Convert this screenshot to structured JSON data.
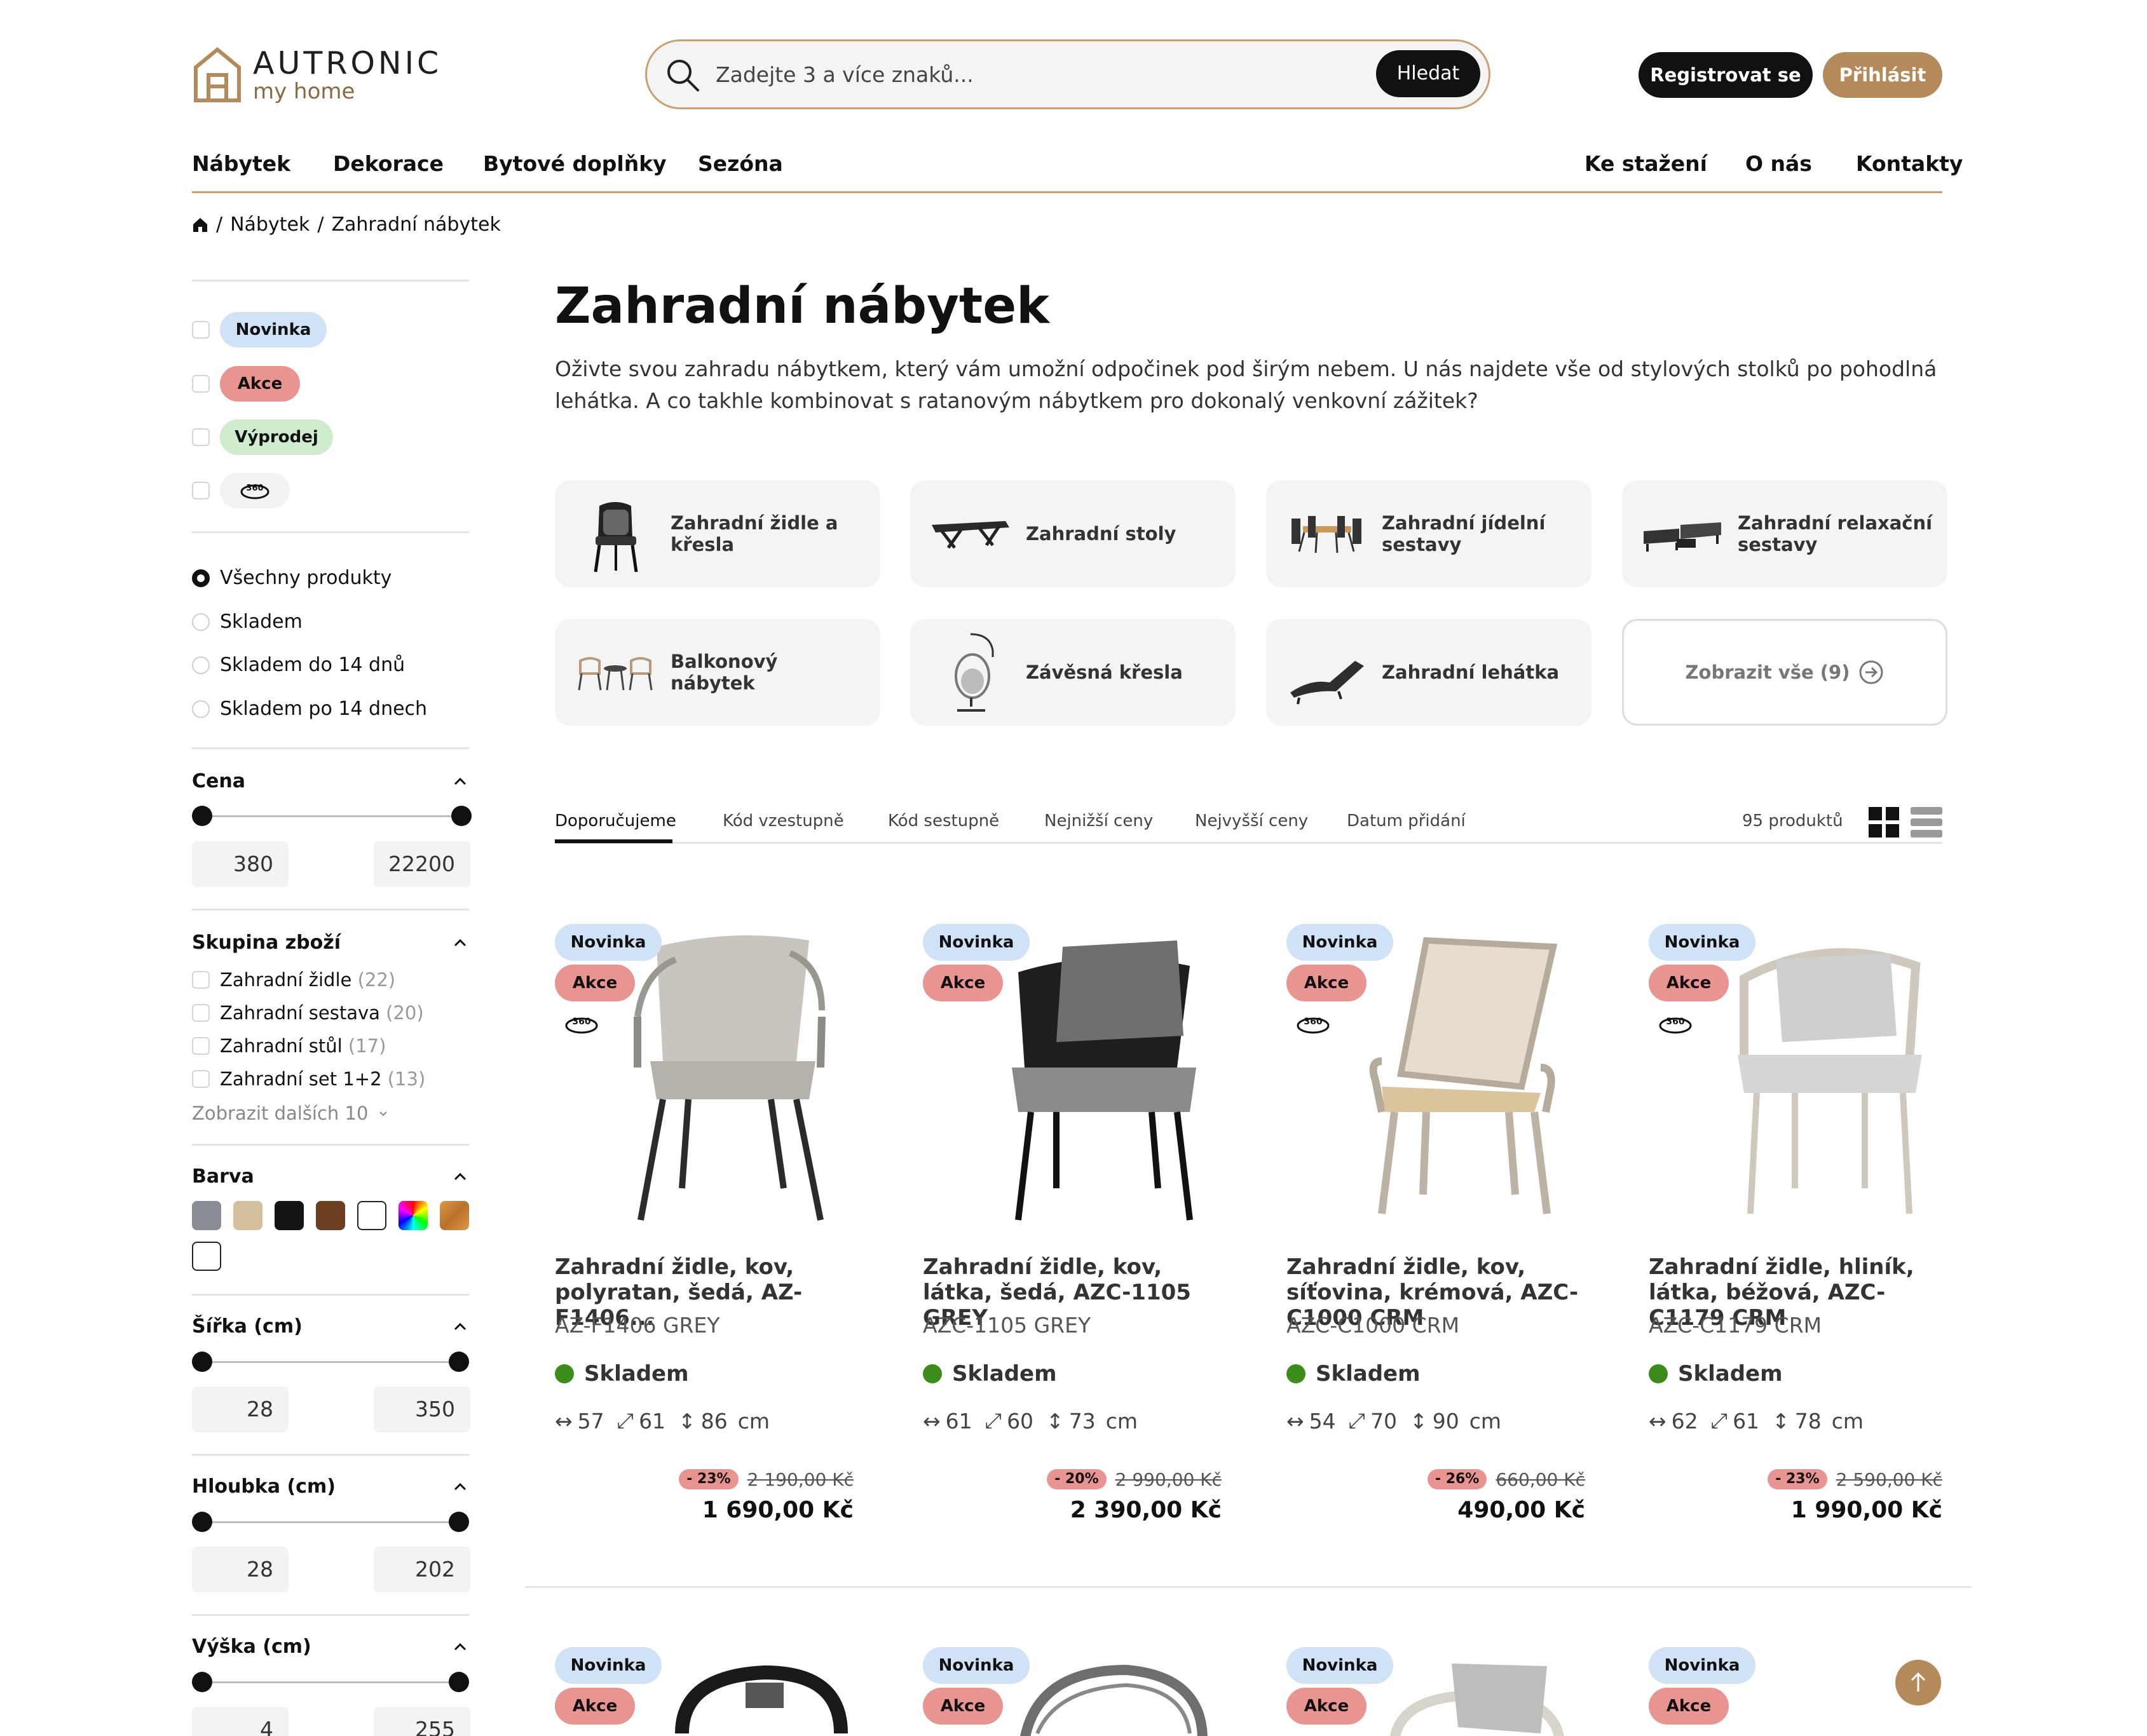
{
  "brand": {
    "name": "AUTRONIC",
    "tagline": "my home",
    "accent": "#b48a5a"
  },
  "search": {
    "placeholder": "Zadejte 3 a více znaků...",
    "button": "Hledat"
  },
  "account": {
    "register": "Registrovat se",
    "login": "Přihlásit"
  },
  "nav": {
    "left": [
      "Nábytek",
      "Dekorace",
      "Bytové doplňky",
      "Sezóna"
    ],
    "right": [
      "Ke stažení",
      "O nás",
      "Kontakty"
    ]
  },
  "breadcrumb": {
    "sep": "/",
    "items": [
      "Nábytek",
      "Zahradní nábytek"
    ]
  },
  "filters": {
    "labels": [
      {
        "text": "Novinka",
        "color": "#cfe2f6"
      },
      {
        "text": "Akce",
        "color": "#e89491"
      },
      {
        "text": "Výprodej",
        "color": "#cfeccc"
      },
      {
        "icon": "360-view-icon"
      }
    ],
    "availability": {
      "selected": 0,
      "options": [
        "Všechny produkty",
        "Skladem",
        "Skladem do 14 dnů",
        "Skladem po 14 dnech"
      ]
    },
    "price": {
      "title": "Cena",
      "min": "380",
      "max": "22200"
    },
    "groups": {
      "title": "Skupina zboží",
      "items": [
        {
          "name": "Zahradní židle",
          "count": "(22)"
        },
        {
          "name": "Zahradní sestava",
          "count": "(20)"
        },
        {
          "name": "Zahradní stůl",
          "count": "(17)"
        },
        {
          "name": "Zahradní set 1+2",
          "count": "(13)"
        }
      ],
      "more": "Zobrazit dalších 10"
    },
    "color": {
      "title": "Barva",
      "swatches": [
        "#8a8d95",
        "#d4bf9c",
        "#141414",
        "#6b3f1f",
        "#ffffff",
        "multicolor",
        "#c8803a",
        "#ffffff"
      ]
    },
    "width": {
      "title": "Šířka (cm)",
      "min": "28",
      "max": "350"
    },
    "depth": {
      "title": "Hloubka (cm)",
      "min": "28",
      "max": "202"
    },
    "height": {
      "title": "Výška (cm)",
      "min": "4",
      "max": "255"
    }
  },
  "page": {
    "title": "Zahradní nábytek",
    "description": "Oživte svou zahradu nábytkem, který vám umožní odpočinek pod širým nebem. U nás najdete vše od stylových stolků po pohodlná lehátka. A co takhle kombinovat s ratanovým nábytkem pro dokonalý venkovní zážitek?"
  },
  "categories": [
    {
      "label": "Zahradní židle a křesla"
    },
    {
      "label": "Zahradní stoly"
    },
    {
      "label": "Zahradní jídelní sestavy"
    },
    {
      "label": "Zahradní relaxační sestavy"
    },
    {
      "label": "Balkonový nábytek"
    },
    {
      "label": "Závěsná křesla"
    },
    {
      "label": "Zahradní lehátka"
    },
    {
      "label": "Zobrazit vše (9)"
    }
  ],
  "sort": {
    "tabs": [
      "Doporučujeme",
      "Kód vzestupně",
      "Kód sestupně",
      "Nejnižší ceny",
      "Nejvyšší ceny",
      "Datum přidání"
    ],
    "active": 0,
    "count": "95 produktů"
  },
  "badges": {
    "new": "Novinka",
    "sale": "Akce"
  },
  "stock_label": "Skladem",
  "unit": "cm",
  "products": [
    {
      "title": "Zahradní židle, kov, polyratan, šedá, AZ-F1406...",
      "code": "AZ-F1406 GREY",
      "w": "57",
      "d": "61",
      "h": "86",
      "discount": "- 23%",
      "old_price": "2 190,00 Kč",
      "price": "1 690,00 Kč"
    },
    {
      "title": "Zahradní židle, kov, látka, šedá, AZC-1105 GREY",
      "code": "AZC-1105 GREY",
      "w": "61",
      "d": "60",
      "h": "73",
      "discount": "- 20%",
      "old_price": "2 990,00 Kč",
      "price": "2 390,00 Kč"
    },
    {
      "title": "Zahradní židle, kov, síťovina, krémová, AZC-C1000 CRM",
      "code": "AZC-C1000 CRM",
      "w": "54",
      "d": "70",
      "h": "90",
      "discount": "- 26%",
      "old_price": "660,00 Kč",
      "price": "490,00 Kč"
    },
    {
      "title": "Zahradní židle, hliník, látka, béžová, AZC-C1179 CRM",
      "code": "AZC-C1179 CRM",
      "w": "62",
      "d": "61",
      "h": "78",
      "discount": "- 23%",
      "old_price": "2 590,00 Kč",
      "price": "1 990,00 Kč"
    }
  ]
}
